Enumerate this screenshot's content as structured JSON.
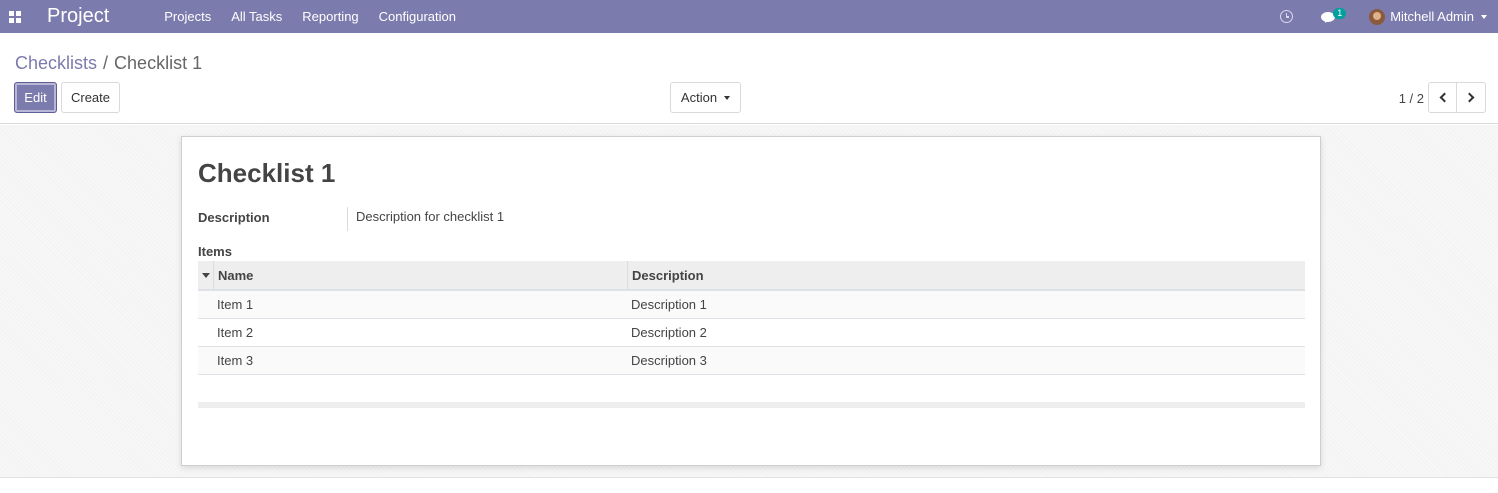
{
  "navbar": {
    "app_name": "Project",
    "menu": [
      "Projects",
      "All Tasks",
      "Reporting",
      "Configuration"
    ],
    "messages_count": "1",
    "user_name": "Mitchell Admin",
    "color": "#7c7bad"
  },
  "breadcrumb": {
    "parent": "Checklists",
    "separator": "/",
    "current": "Checklist 1"
  },
  "toolbar": {
    "edit_label": "Edit",
    "create_label": "Create",
    "action_label": "Action",
    "pager": "1 / 2"
  },
  "record": {
    "title": "Checklist 1",
    "description_label": "Description",
    "description_value": "Description for checklist 1",
    "items_label": "Items"
  },
  "items_table": {
    "headers": [
      "Name",
      "Description"
    ],
    "rows": [
      {
        "name": "Item 1",
        "description": "Description 1"
      },
      {
        "name": "Item 2",
        "description": "Description 2"
      },
      {
        "name": "Item 3",
        "description": "Description 3"
      }
    ]
  }
}
